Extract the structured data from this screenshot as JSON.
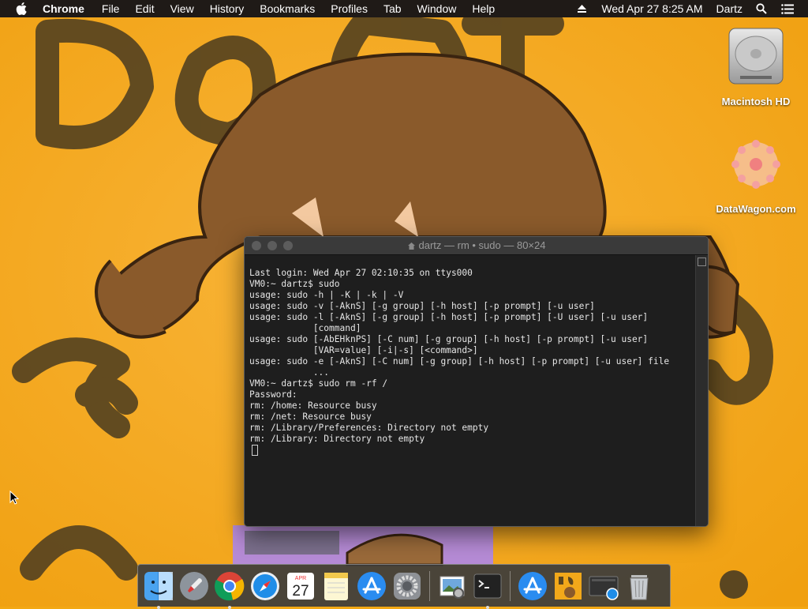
{
  "menubar": {
    "app_name": "Chrome",
    "items": [
      "File",
      "Edit",
      "View",
      "History",
      "Bookmarks",
      "Profiles",
      "Tab",
      "Window",
      "Help"
    ],
    "datetime": "Wed Apr 27  8:25 AM",
    "user": "Dartz"
  },
  "desktop": {
    "icons": [
      {
        "label": "Macintosh HD"
      },
      {
        "label": "DataWagon.com"
      }
    ]
  },
  "terminal": {
    "title": "dartz — rm • sudo — 80×24",
    "lines": [
      "Last login: Wed Apr 27 02:10:35 on ttys000",
      "VM0:~ dartz$ sudo",
      "usage: sudo -h | -K | -k | -V",
      "usage: sudo -v [-AknS] [-g group] [-h host] [-p prompt] [-u user]",
      "usage: sudo -l [-AknS] [-g group] [-h host] [-p prompt] [-U user] [-u user]",
      "            [command]",
      "usage: sudo [-AbEHknPS] [-C num] [-g group] [-h host] [-p prompt] [-u user]",
      "            [VAR=value] [-i|-s] [<command>]",
      "usage: sudo -e [-AknS] [-C num] [-g group] [-h host] [-p prompt] [-u user] file",
      "            ...",
      "VM0:~ dartz$ sudo rm -rf /",
      "Password:",
      "rm: /home: Resource busy",
      "rm: /net: Resource busy",
      "rm: /Library/Preferences: Directory not empty",
      "rm: /Library: Directory not empty"
    ]
  },
  "dock": {
    "items": [
      {
        "name": "Finder",
        "icon": "finder-icon"
      },
      {
        "name": "Launchpad",
        "icon": "rocket-icon"
      },
      {
        "name": "Google Chrome",
        "icon": "chrome-icon"
      },
      {
        "name": "Safari",
        "icon": "compass-icon"
      },
      {
        "name": "Calendar",
        "icon": "calendar-icon",
        "month": "APR",
        "day": "27"
      },
      {
        "name": "Notes",
        "icon": "notes-icon"
      },
      {
        "name": "App Store",
        "icon": "app-store-icon"
      },
      {
        "name": "System Preferences",
        "icon": "gear-icon"
      },
      {
        "name": "Preview",
        "icon": "preview-icon"
      },
      {
        "name": "Terminal",
        "icon": "terminal-icon"
      },
      {
        "name": "Downloads",
        "icon": "app-store-icon"
      },
      {
        "name": "Image",
        "icon": "image-icon"
      },
      {
        "name": "Screen",
        "icon": "screen-icon"
      },
      {
        "name": "Trash",
        "icon": "trash-icon"
      }
    ]
  }
}
